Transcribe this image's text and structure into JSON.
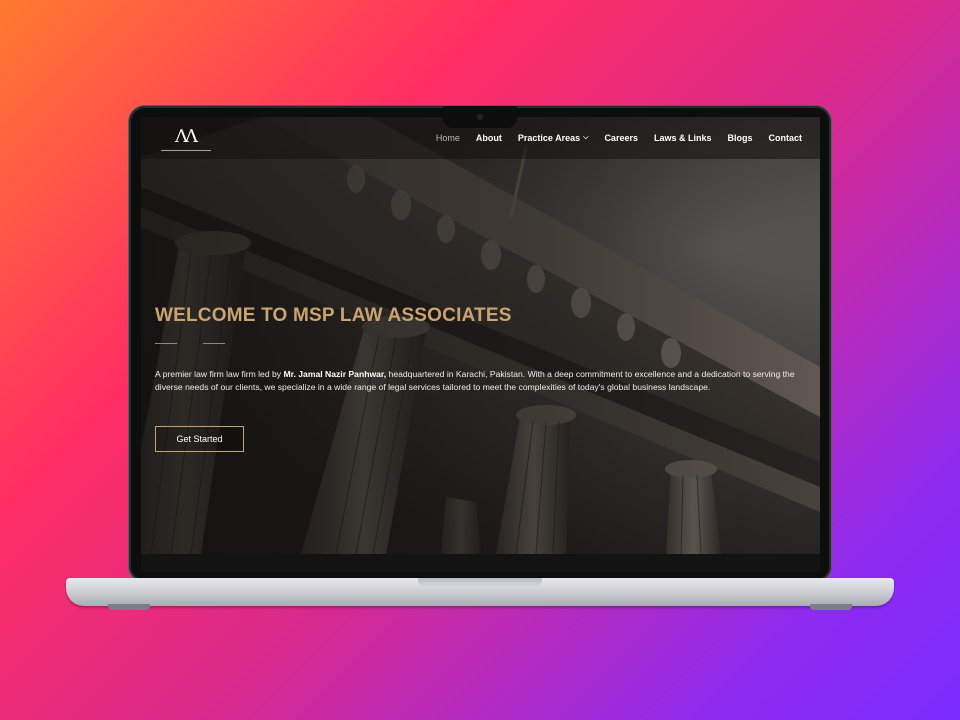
{
  "nav": {
    "items": [
      {
        "label": "Home",
        "active": true
      },
      {
        "label": "About"
      },
      {
        "label": "Practice Areas",
        "dropdown": true
      },
      {
        "label": "Careers"
      },
      {
        "label": "Laws & Links"
      },
      {
        "label": "Blogs"
      },
      {
        "label": "Contact"
      }
    ]
  },
  "logo": {
    "mark": "ΛΛ",
    "icon": "msp-law-logo-icon"
  },
  "hero": {
    "title": "WELCOME TO MSP LAW ASSOCIATES",
    "para_prefix": "A premier law firm law firm led by ",
    "para_bold": "Mr. Jamal Nazir Panhwar,",
    "para_suffix": " headquartered in Karachi, Pakistan. With a deep commitment to excellence and a dedication to serving the diverse needs of our clients, we specialize in a wide range of legal services tailored to meet the complexities of today's global business landscape.",
    "cta_label": "Get Started"
  },
  "colors": {
    "accent_gold": "#c9a372",
    "background_gradient_start": "#ff7a2f",
    "background_gradient_end": "#7b2cff"
  }
}
